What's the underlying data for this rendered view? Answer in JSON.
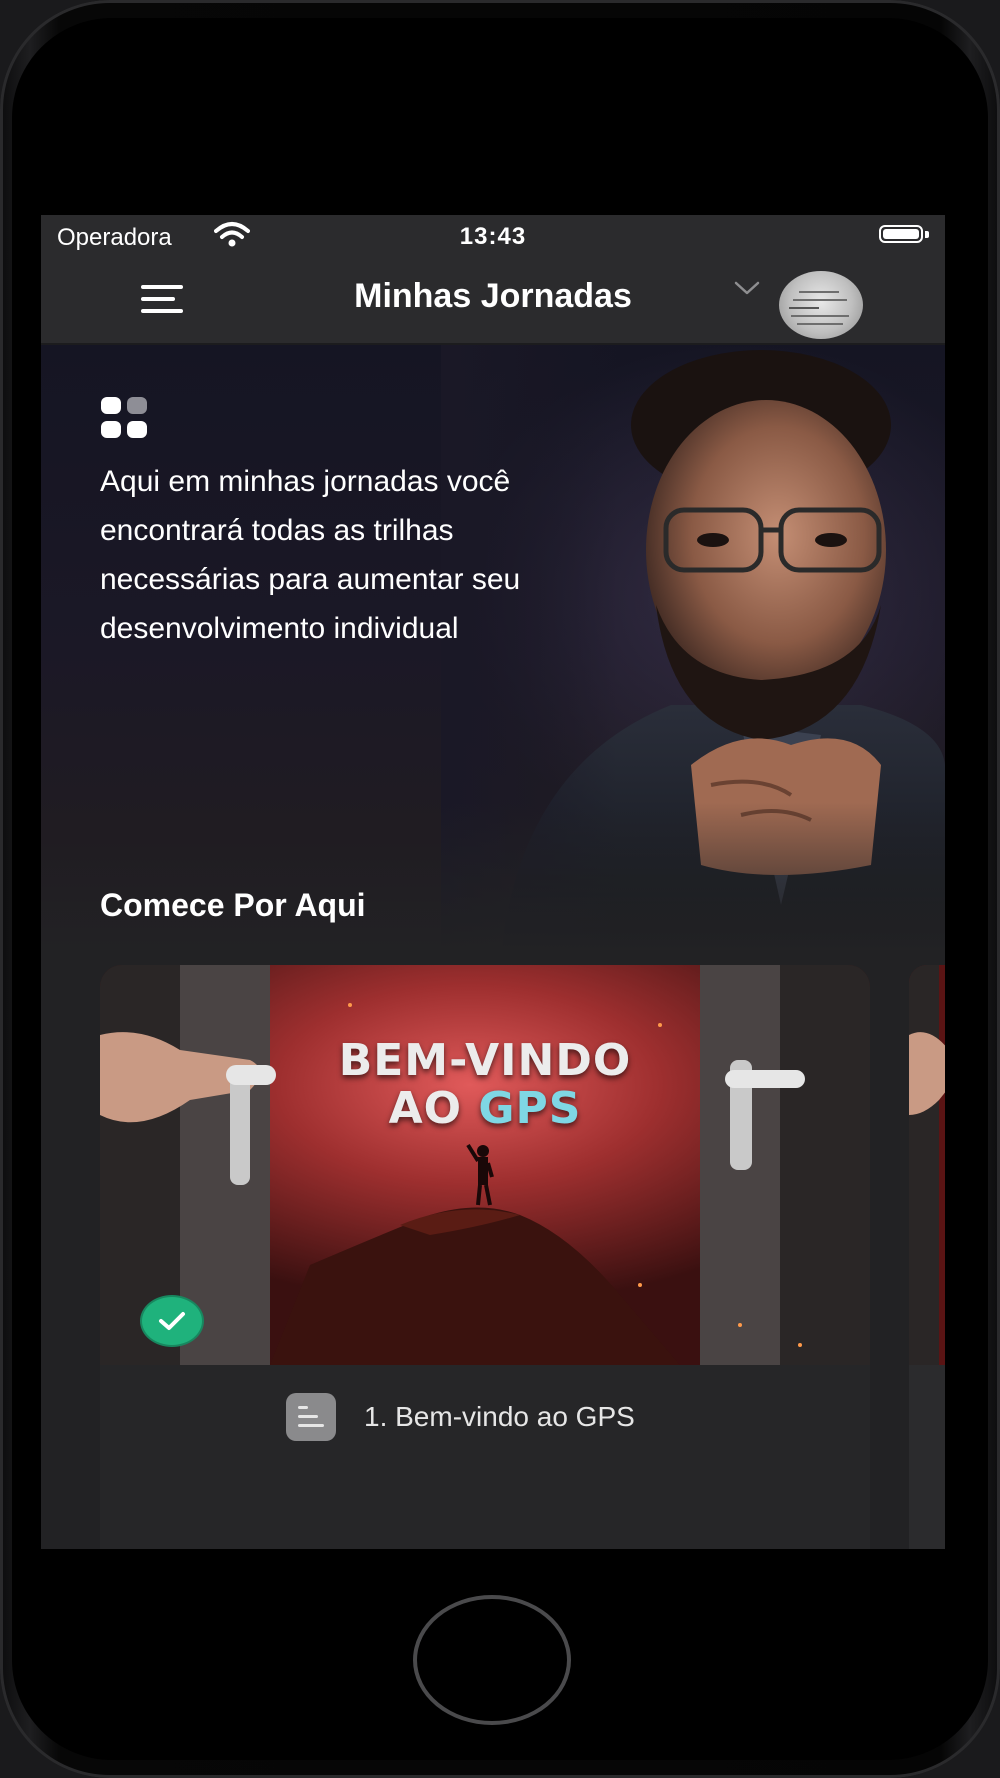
{
  "status_bar": {
    "carrier": "Operadora",
    "time": "13:43"
  },
  "header": {
    "title": "Minhas Jornadas"
  },
  "hero": {
    "text": "Aqui em minhas jornadas você encontrará todas as trilhas necessárias para aumentar seu desenvolvimento individual"
  },
  "section": {
    "title": "Comece Por Aqui"
  },
  "card": {
    "image_title_line1": "BEM-VINDO",
    "image_title_line2_prefix": "AO ",
    "image_title_line2_highlight": "GPS",
    "lesson_label": "1. Bem-vindo ao GPS",
    "completed": true
  },
  "colors": {
    "check_badge": "#1fb27c",
    "gps_highlight": "#7fd7e4"
  }
}
